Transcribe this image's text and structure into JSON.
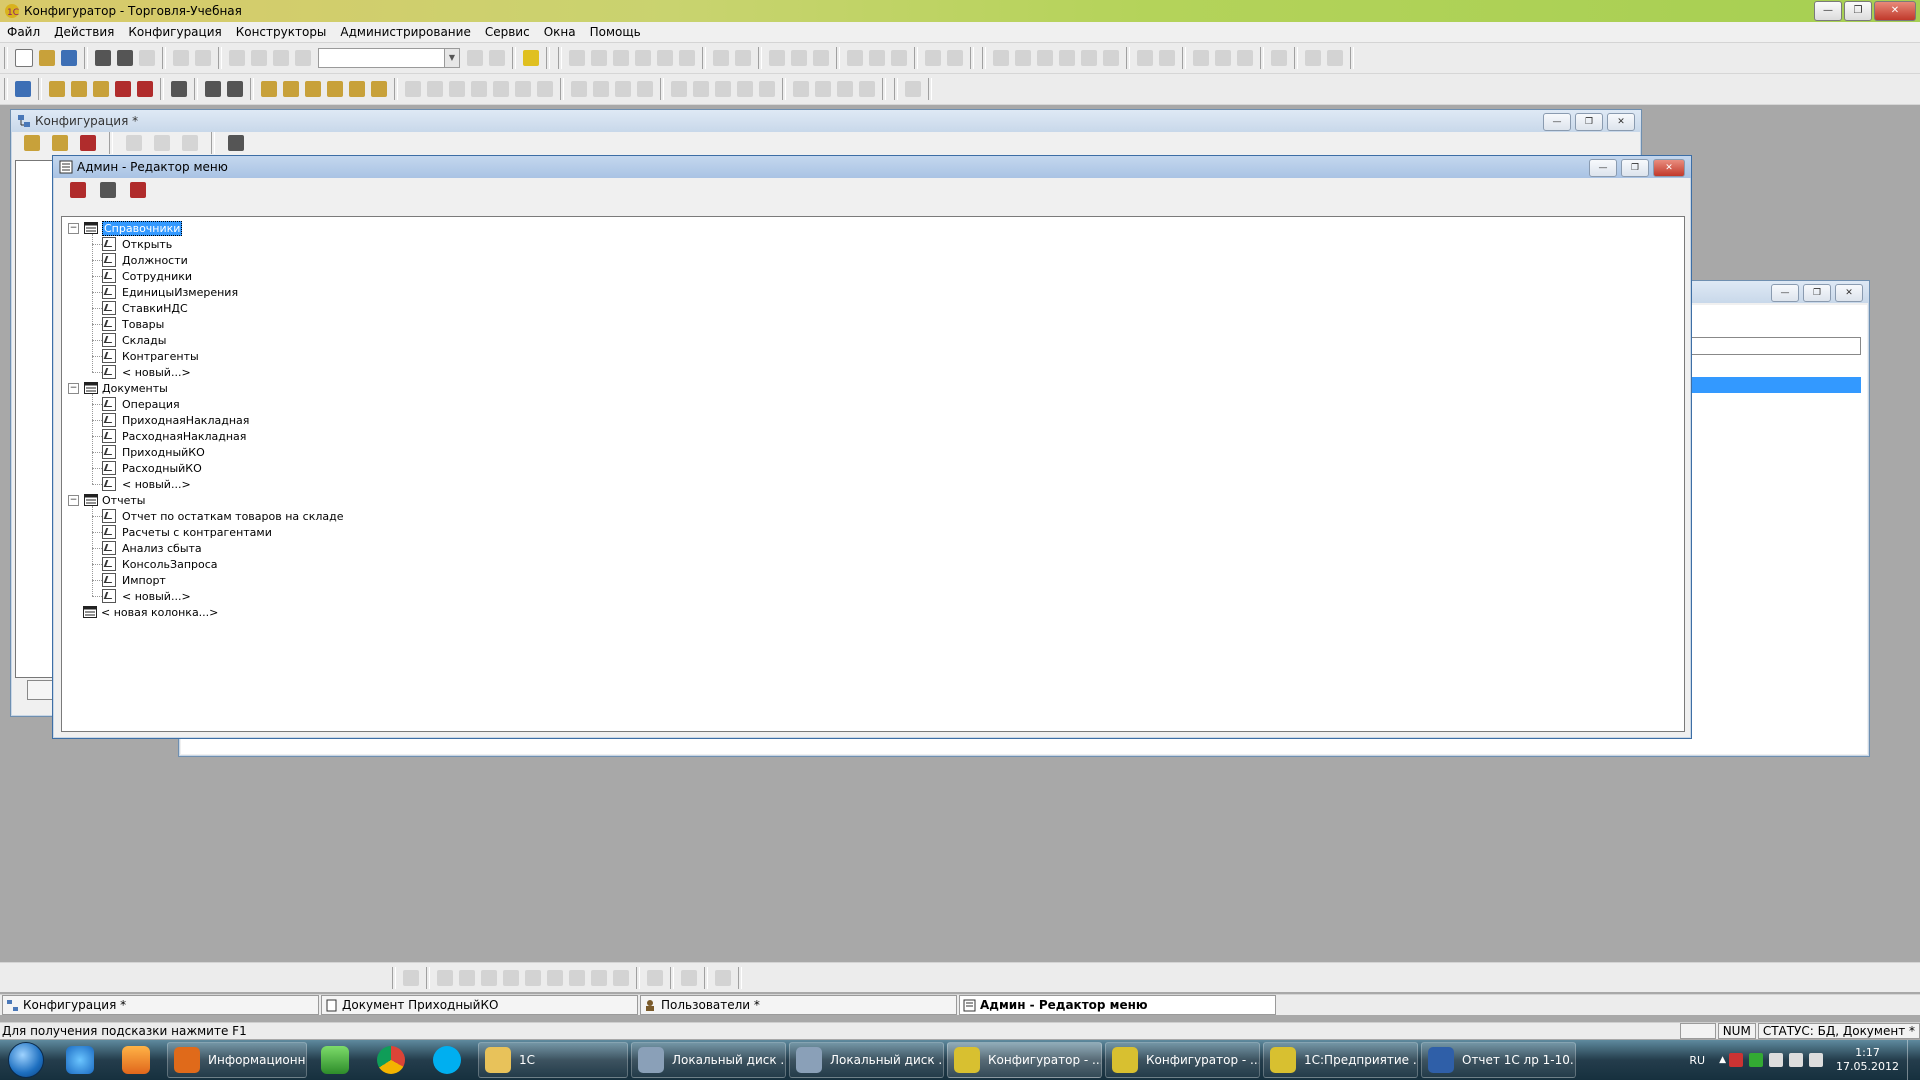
{
  "app": {
    "title": "Конфигуратор - Торговля-Учебная",
    "menu": [
      "Файл",
      "Действия",
      "Конфигурация",
      "Конструкторы",
      "Администрирование",
      "Сервис",
      "Окна",
      "Помощь"
    ]
  },
  "windows": {
    "config": {
      "title": "Конфигурация *"
    },
    "menu_editor": {
      "title": "Админ - Редактор меню",
      "tree": [
        {
          "label": "Справочники",
          "selected": true,
          "children": [
            "Открыть",
            "Должности",
            "Сотрудники",
            "ЕдиницыИзмерения",
            "СтавкиНДС",
            "Товары",
            "Склады",
            "Контрагенты",
            "< новый...>"
          ]
        },
        {
          "label": "Документы",
          "children": [
            "Операция",
            "ПриходнаяНакладная",
            "РасходнаяНакладная",
            "ПриходныйКО",
            "РасходныйКО",
            "< новый...>"
          ]
        },
        {
          "label": "Отчеты",
          "children": [
            "Отчет по остаткам товаров на складе",
            "Расчеты с контрагентами",
            "Анализ сбыта",
            "КонсольЗапроса",
            "Импорт",
            "< новый...>"
          ]
        },
        {
          "label": "< новая колонка...>",
          "children": []
        }
      ]
    }
  },
  "window_tabs": [
    {
      "label": "Конфигурация *",
      "active": false
    },
    {
      "label": "Документ ПриходныйКО",
      "active": false
    },
    {
      "label": "Пользователи *",
      "active": false
    },
    {
      "label": "Админ - Редактор меню",
      "active": true
    }
  ],
  "statusbar": {
    "hint": "Для получения подсказки нажмите F1",
    "num": "NUM",
    "status": "СТАТУС: БД, Документ *"
  },
  "taskbar": {
    "tasks": [
      {
        "label": "Информационн...",
        "icon_color": "#e06a1a"
      },
      {
        "label": "1С",
        "icon_color": "#e8c25a"
      },
      {
        "label": "Локальный диск ...",
        "icon_color": "#8aa0b8"
      },
      {
        "label": "Локальный диск ...",
        "icon_color": "#8aa0b8"
      },
      {
        "label": "Конфигуратор - ...",
        "icon_color": "#d8c030"
      },
      {
        "label": "Конфигуратор - ...",
        "icon_color": "#d8c030"
      },
      {
        "label": "1С:Предприятие ...",
        "icon_color": "#d8c030"
      },
      {
        "label": "Отчет 1С лр 1-10...",
        "icon_color": "#2f5fa8"
      }
    ],
    "lang": "RU",
    "time": "1:17",
    "date": "17.05.2012"
  }
}
